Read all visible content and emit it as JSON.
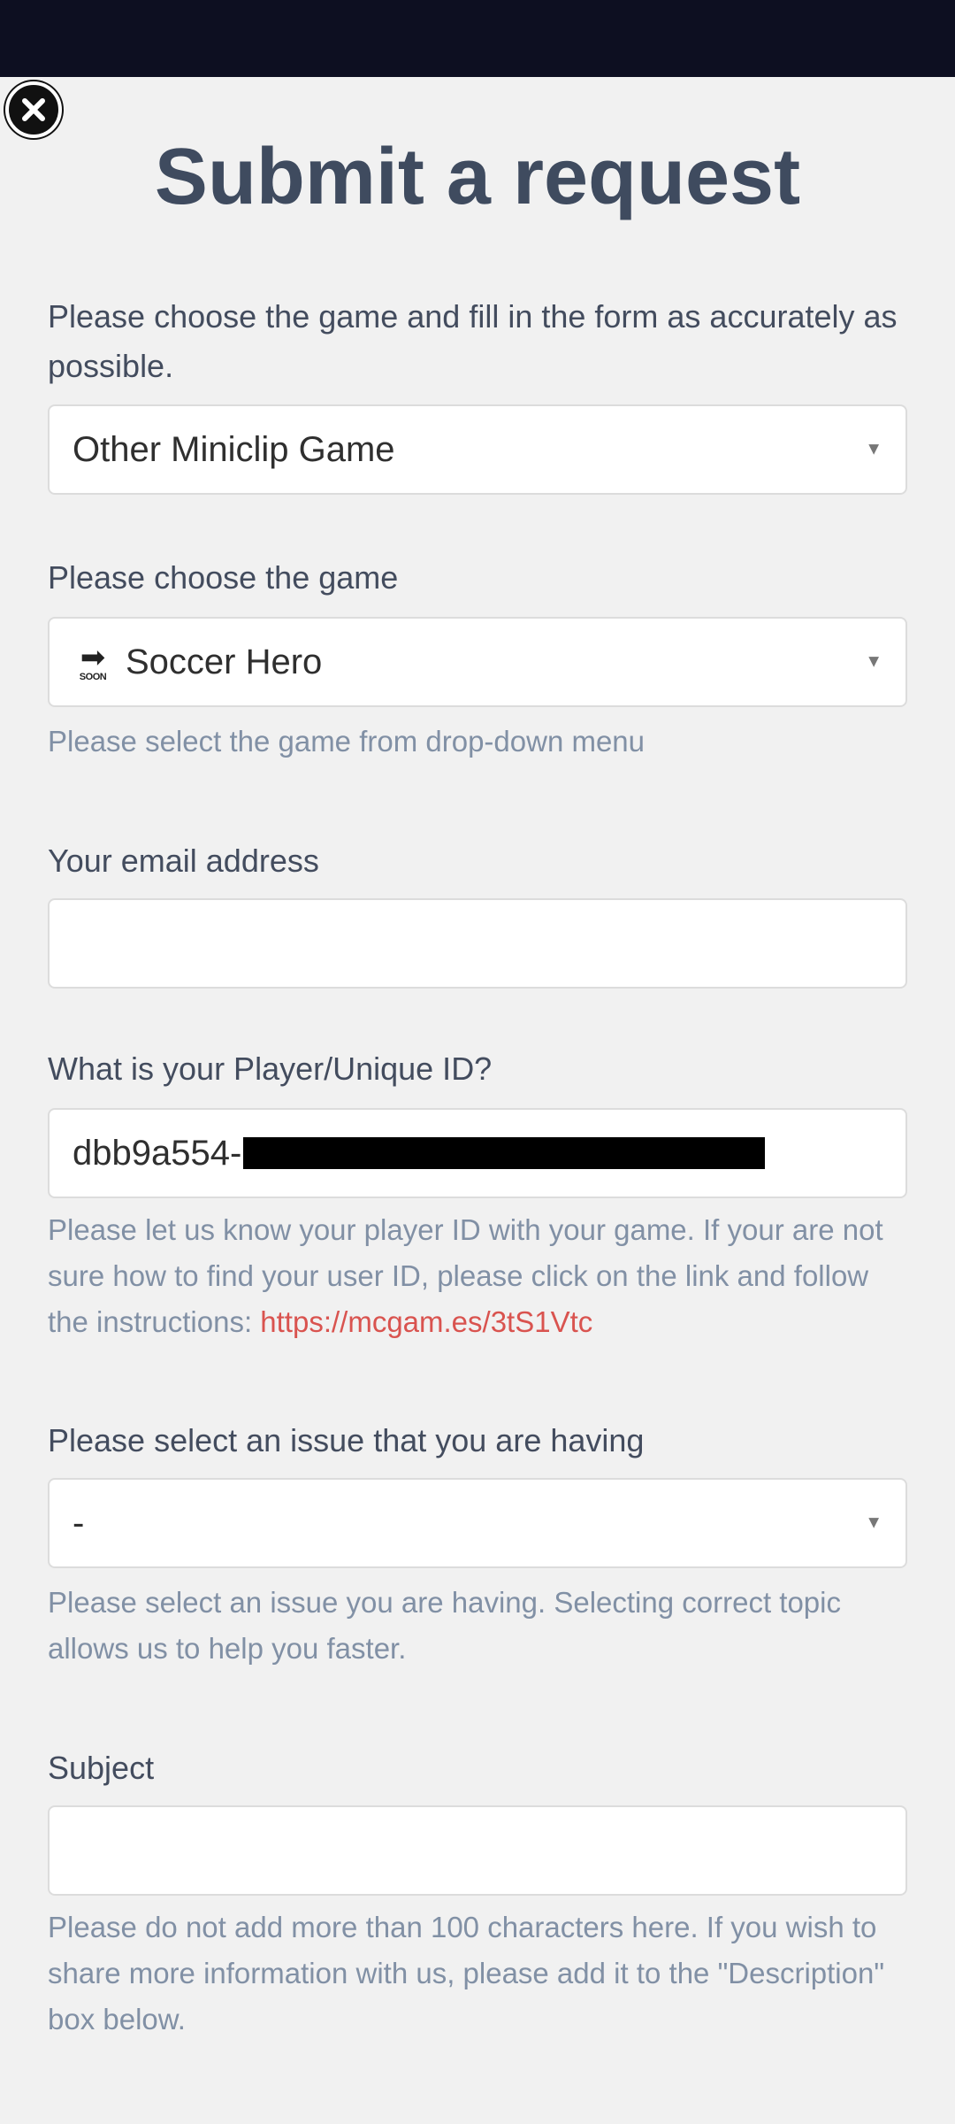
{
  "header": {
    "title": "Submit a request"
  },
  "form": {
    "intro": "Please choose the game and fill in the form as accurately as possible.",
    "category_select": {
      "value": "Other Miniclip Game"
    },
    "game_label": "Please choose the game",
    "game_select": {
      "icon_text": "SOON",
      "value": "Soccer Hero"
    },
    "game_hint": "Please select the game from drop-down menu",
    "email_label": "Your email address",
    "email_value": "",
    "player_id_label": "What is your Player/Unique ID?",
    "player_id_value": "dbb9a554-",
    "player_id_hint": "Please let us know your player ID with your game. If your are not sure how to find your user ID, please click on the link and follow the instructions: ",
    "player_id_link": "https://mcgam.es/3tS1Vtc",
    "issue_label": "Please select an issue that you are having",
    "issue_select": {
      "value": "-"
    },
    "issue_hint": "Please select an issue you are having. Selecting correct topic allows us to help you faster.",
    "subject_label": "Subject",
    "subject_value": "",
    "subject_hint": "Please do not add more than 100 characters here. If you wish to share more information with us, please add it to the \"Description\" box below."
  },
  "icons": {
    "close": "close-icon",
    "dropdown": "chevron-down-icon",
    "game_icon": "soon-arrow-icon"
  },
  "colors": {
    "status_bar": "#0d0f21",
    "title": "#3f4b5f",
    "hint": "#8190a5",
    "link": "#d9534f",
    "background": "#f1f1f1"
  }
}
